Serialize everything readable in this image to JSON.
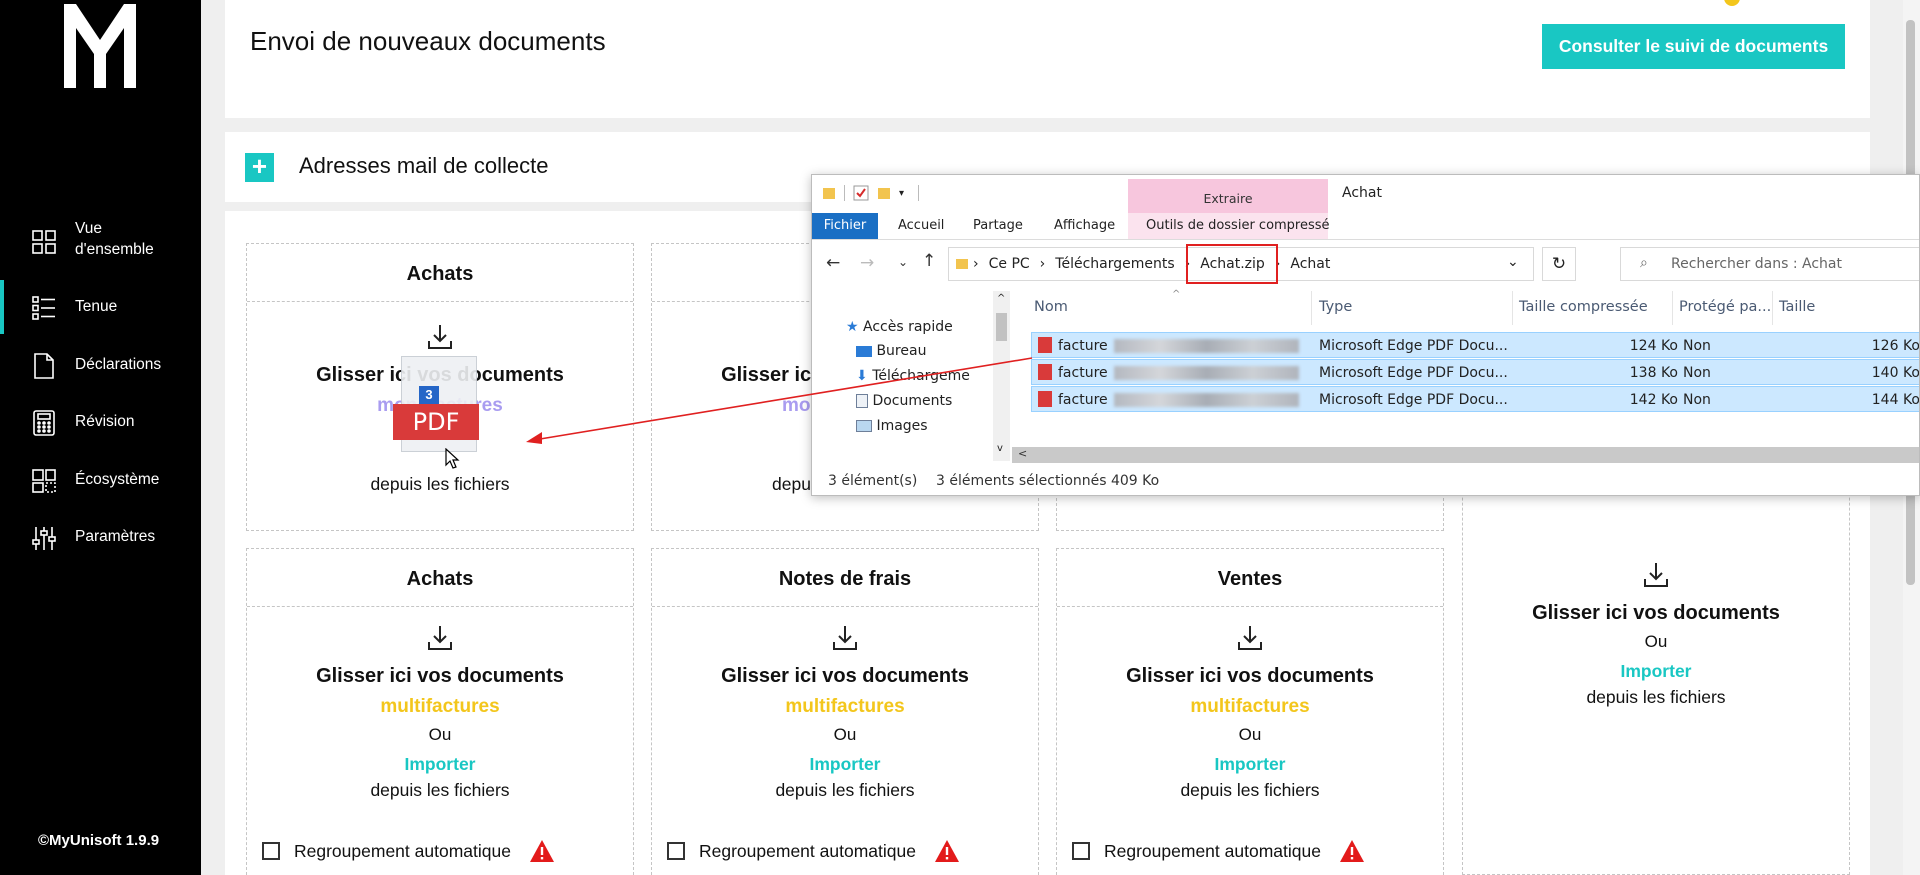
{
  "app": {
    "version": "©MyUnisoft 1.9.9",
    "brand_color": "#19c7c3",
    "accent_yellow": "#f3c61c"
  },
  "sidebar": {
    "items": [
      {
        "label": "Vue d'ensemble",
        "icon": "dashboard-grid-icon",
        "active": false
      },
      {
        "label": "Tenue",
        "icon": "list-icon",
        "active": true
      },
      {
        "label": "Déclarations",
        "icon": "document-icon",
        "active": false
      },
      {
        "label": "Révision",
        "icon": "calculator-icon",
        "active": false
      },
      {
        "label": "Écosystème",
        "icon": "ecosystem-icon",
        "active": false
      },
      {
        "label": "Paramètres",
        "icon": "sliders-icon",
        "active": false
      }
    ]
  },
  "header": {
    "title": "Envoi de nouveaux documents",
    "track_button": "Consulter le suivi de documents"
  },
  "collect": {
    "plus": "+",
    "title": "Adresses mail de collecte"
  },
  "zones": {
    "drop_text": "Glisser ici vos documents",
    "multi_text": "multifactures",
    "or_text": "Ou",
    "import_text": "Importer",
    "from_files": "depuis les fichiers",
    "regroup_label": "Regroupement automatique",
    "row1": [
      {
        "title": "Achats"
      },
      {
        "title": "Not"
      }
    ],
    "row2": [
      {
        "title": "Achats"
      },
      {
        "title": "Notes de frais"
      },
      {
        "title": "Ventes"
      }
    ],
    "partial_row1_ghost": "mo",
    "partial_row1_depuis": "depu",
    "drag_ghost_multi": "monofactures",
    "drag_badge": "3",
    "drag_pdf": "PDF"
  },
  "explorer": {
    "ribbon_context": "Extraire",
    "window_title": "Achat",
    "tabs": [
      "Fichier",
      "Accueil",
      "Partage",
      "Affichage",
      "Outils de dossier compressé"
    ],
    "path": [
      "Ce PC",
      "Téléchargements",
      "Achat.zip",
      "Achat"
    ],
    "search_placeholder": "Rechercher dans : Achat",
    "nav_tree": [
      {
        "label": "Accès rapide",
        "icon": "star-icon"
      },
      {
        "label": "Bureau",
        "icon": "desktop-icon"
      },
      {
        "label": "Téléchargeme",
        "icon": "download-icon"
      },
      {
        "label": "Documents",
        "icon": "documents-icon"
      },
      {
        "label": "Images",
        "icon": "images-icon"
      }
    ],
    "columns": [
      "Nom",
      "Type",
      "Taille compressée",
      "Protégé pa...",
      "Taille"
    ],
    "files": [
      {
        "name": "facture",
        "type": "Microsoft Edge PDF Docu...",
        "compressed": "124 Ko",
        "protected": "Non",
        "size": "126 Ko"
      },
      {
        "name": "facture",
        "type": "Microsoft Edge PDF Docu...",
        "compressed": "138 Ko",
        "protected": "Non",
        "size": "140 Ko"
      },
      {
        "name": "facture",
        "type": "Microsoft Edge PDF Docu...",
        "compressed": "142 Ko",
        "protected": "Non",
        "size": "144 Ko"
      }
    ],
    "status_count": "3 élément(s)",
    "status_selected": "3 éléments sélectionnés  409 Ko"
  }
}
